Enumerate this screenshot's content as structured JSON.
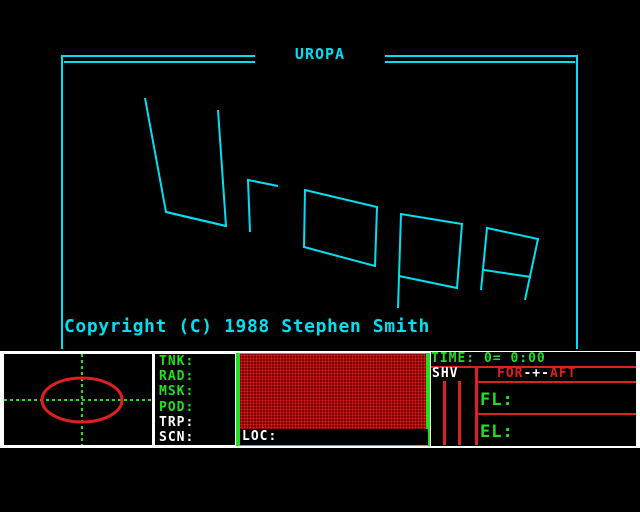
{
  "title_screen": {
    "banner_title": "UROPA",
    "copyright": "Copyright (C) 1988 Stephen Smith"
  },
  "hud": {
    "status_labels": [
      "TNK:",
      "RAD:",
      "MSK:",
      "POD:",
      "TRP:",
      "SCN:"
    ],
    "loc_label": "LOC:",
    "time_label": "TIME:",
    "time_value": "0= 0:00",
    "shv_label": "SHV",
    "for_label": "FOR",
    "mid_label": "-+-",
    "aft_label": "AFT",
    "fl_label": "FL:",
    "el_label": "EL:"
  },
  "colors": {
    "cyan": "#00e0f0",
    "green": "#20e020",
    "red": "#e02020",
    "dark_red": "#800000",
    "white": "#ffffff"
  },
  "icons": {
    "radar": "targeting-reticle-icon"
  }
}
